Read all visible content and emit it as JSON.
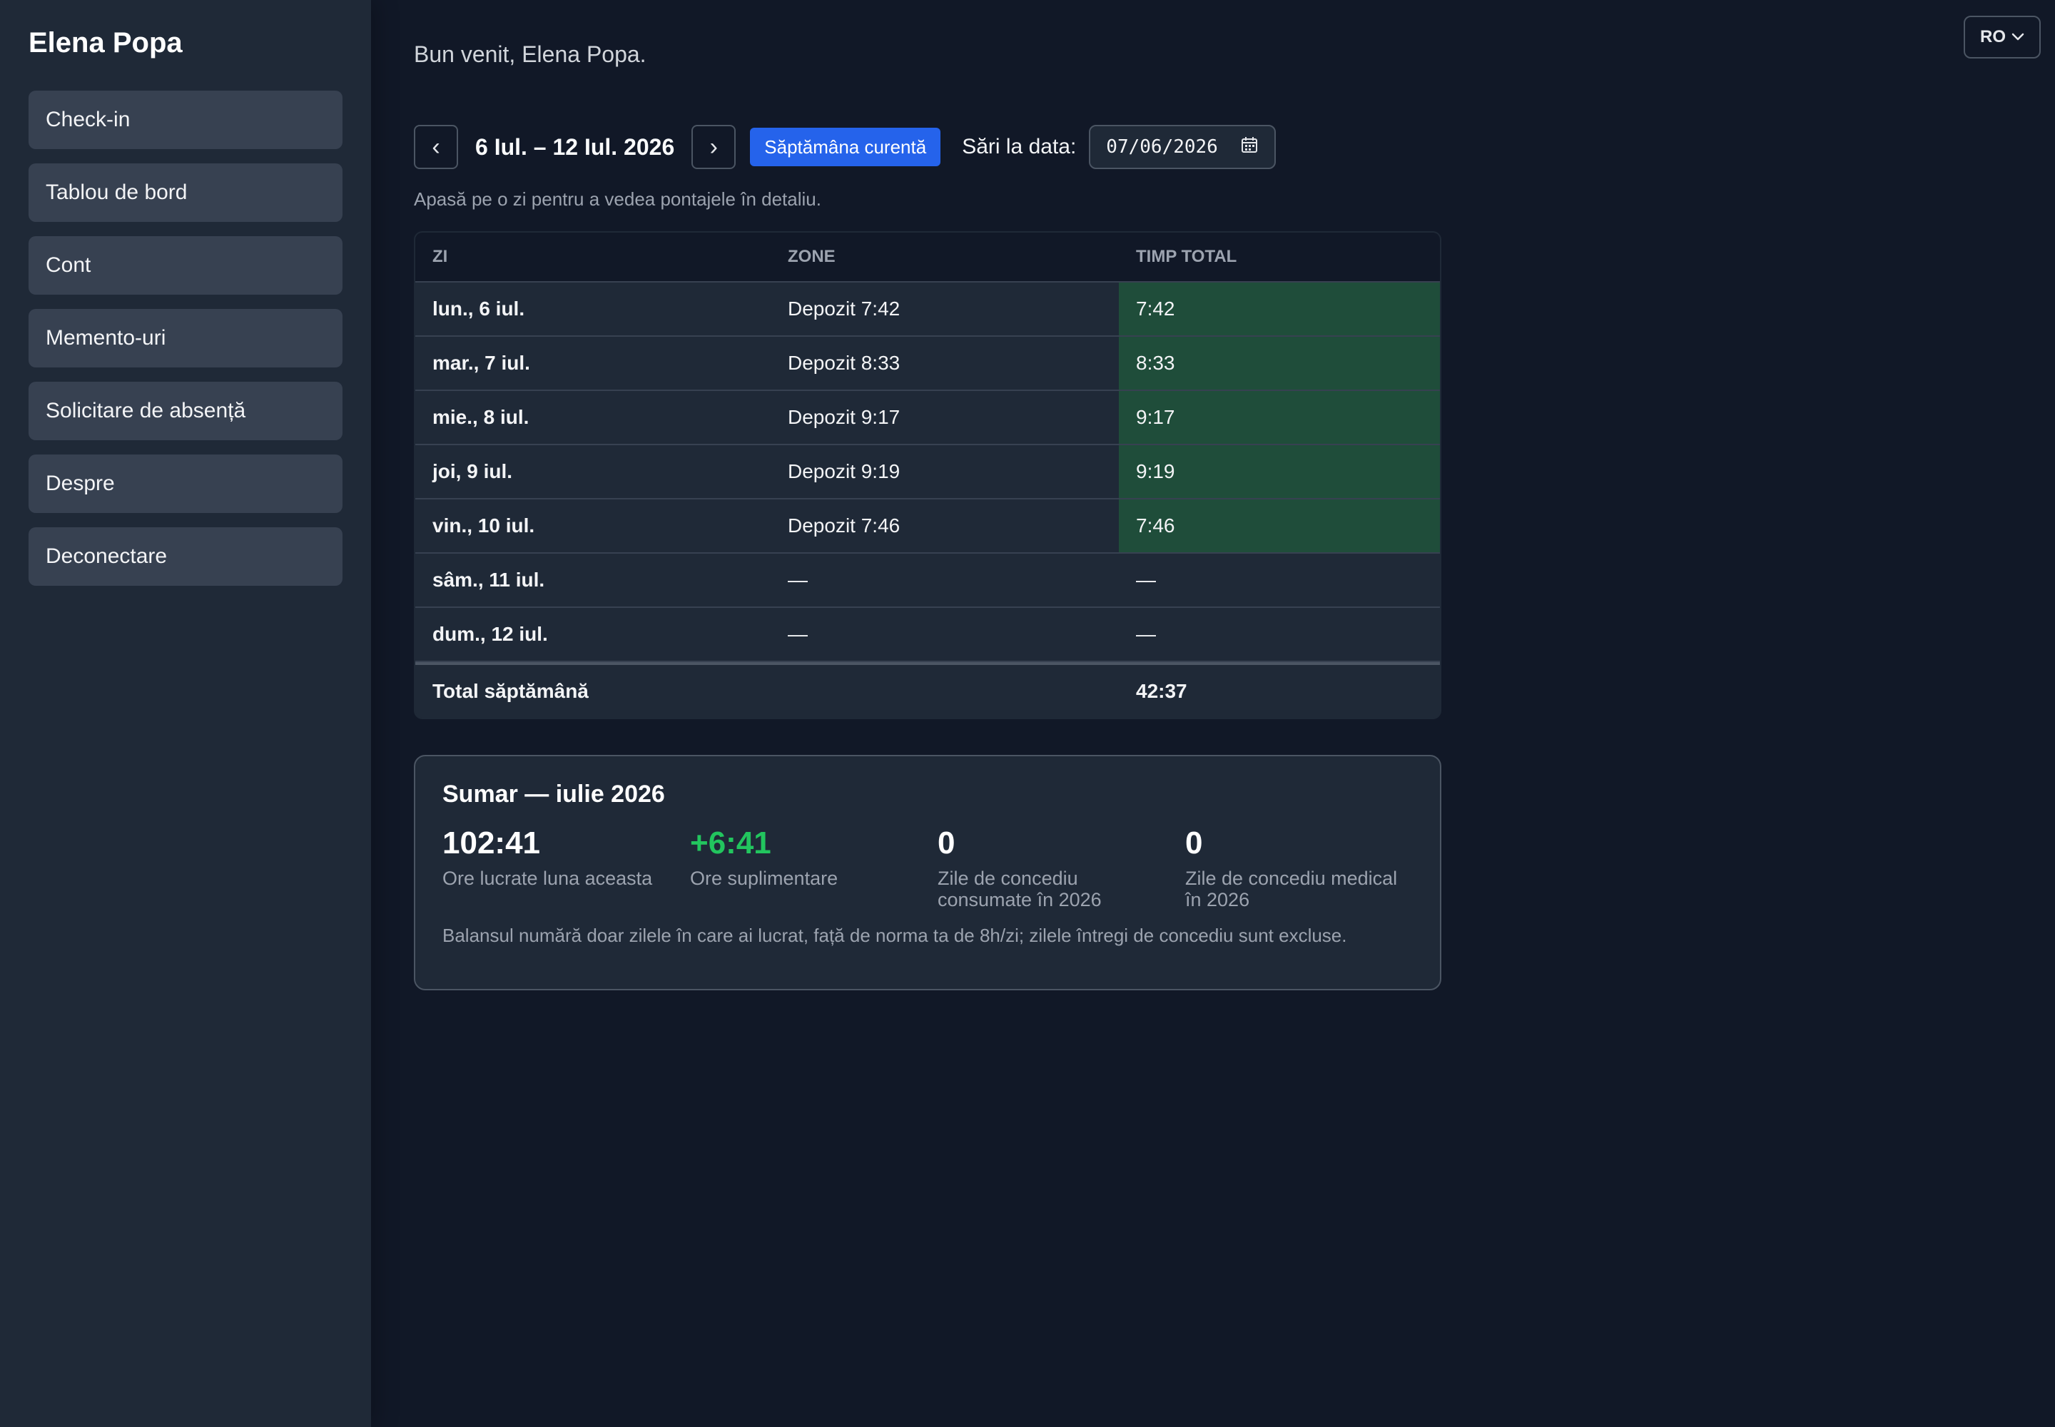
{
  "sidebar": {
    "user_name": "Elena Popa",
    "items": [
      {
        "label": "Check-in"
      },
      {
        "label": "Tablou de bord"
      },
      {
        "label": "Cont"
      },
      {
        "label": "Memento-uri"
      },
      {
        "label": "Solicitare de absență"
      },
      {
        "label": "Despre"
      },
      {
        "label": "Deconectare"
      }
    ]
  },
  "header": {
    "welcome": "Bun venit, Elena Popa.",
    "language": "RO"
  },
  "week_nav": {
    "prev": "‹",
    "next": "›",
    "range": "6 Iul. – 12 Iul. 2026",
    "current_week_label": "Săptămâna curentă",
    "jump_label": "Sări la data:",
    "date_value": "07/06/2026"
  },
  "hint": "Apasă pe o zi pentru a vedea pontajele în detaliu.",
  "table": {
    "headers": {
      "day": "Zi",
      "zone": "Zone",
      "total": "Timp total"
    },
    "rows": [
      {
        "day": "lun., 6 iul.",
        "zone": "Depozit 7:42",
        "total": "7:42",
        "worked": true
      },
      {
        "day": "mar., 7 iul.",
        "zone": "Depozit 8:33",
        "total": "8:33",
        "worked": true
      },
      {
        "day": "mie., 8 iul.",
        "zone": "Depozit 9:17",
        "total": "9:17",
        "worked": true
      },
      {
        "day": "joi, 9 iul.",
        "zone": "Depozit 9:19",
        "total": "9:19",
        "worked": true
      },
      {
        "day": "vin., 10 iul.",
        "zone": "Depozit 7:46",
        "total": "7:46",
        "worked": true
      },
      {
        "day": "sâm., 11 iul.",
        "zone": "—",
        "total": "—",
        "worked": false
      },
      {
        "day": "dum., 12 iul.",
        "zone": "—",
        "total": "—",
        "worked": false
      }
    ],
    "total_label": "Total săptămână",
    "total_value": "42:37"
  },
  "summary": {
    "title": "Sumar — iulie 2026",
    "stats": [
      {
        "value": "102:41",
        "label": "Ore lucrate luna aceasta"
      },
      {
        "value": "+6:41",
        "label": "Ore suplimentare"
      },
      {
        "value": "0",
        "label": "Zile de concediu consumate în 2026"
      },
      {
        "value": "0",
        "label": "Zile de concediu medical în 2026"
      }
    ],
    "note": "Balansul numără doar zilele în care ai lucrat, față de norma ta de 8h/zi; zilele întregi de concediu sunt excluse."
  },
  "colors": {
    "accent": "#2563eb",
    "worked_cell": "#1f4d3a",
    "positive": "#22c55e"
  }
}
